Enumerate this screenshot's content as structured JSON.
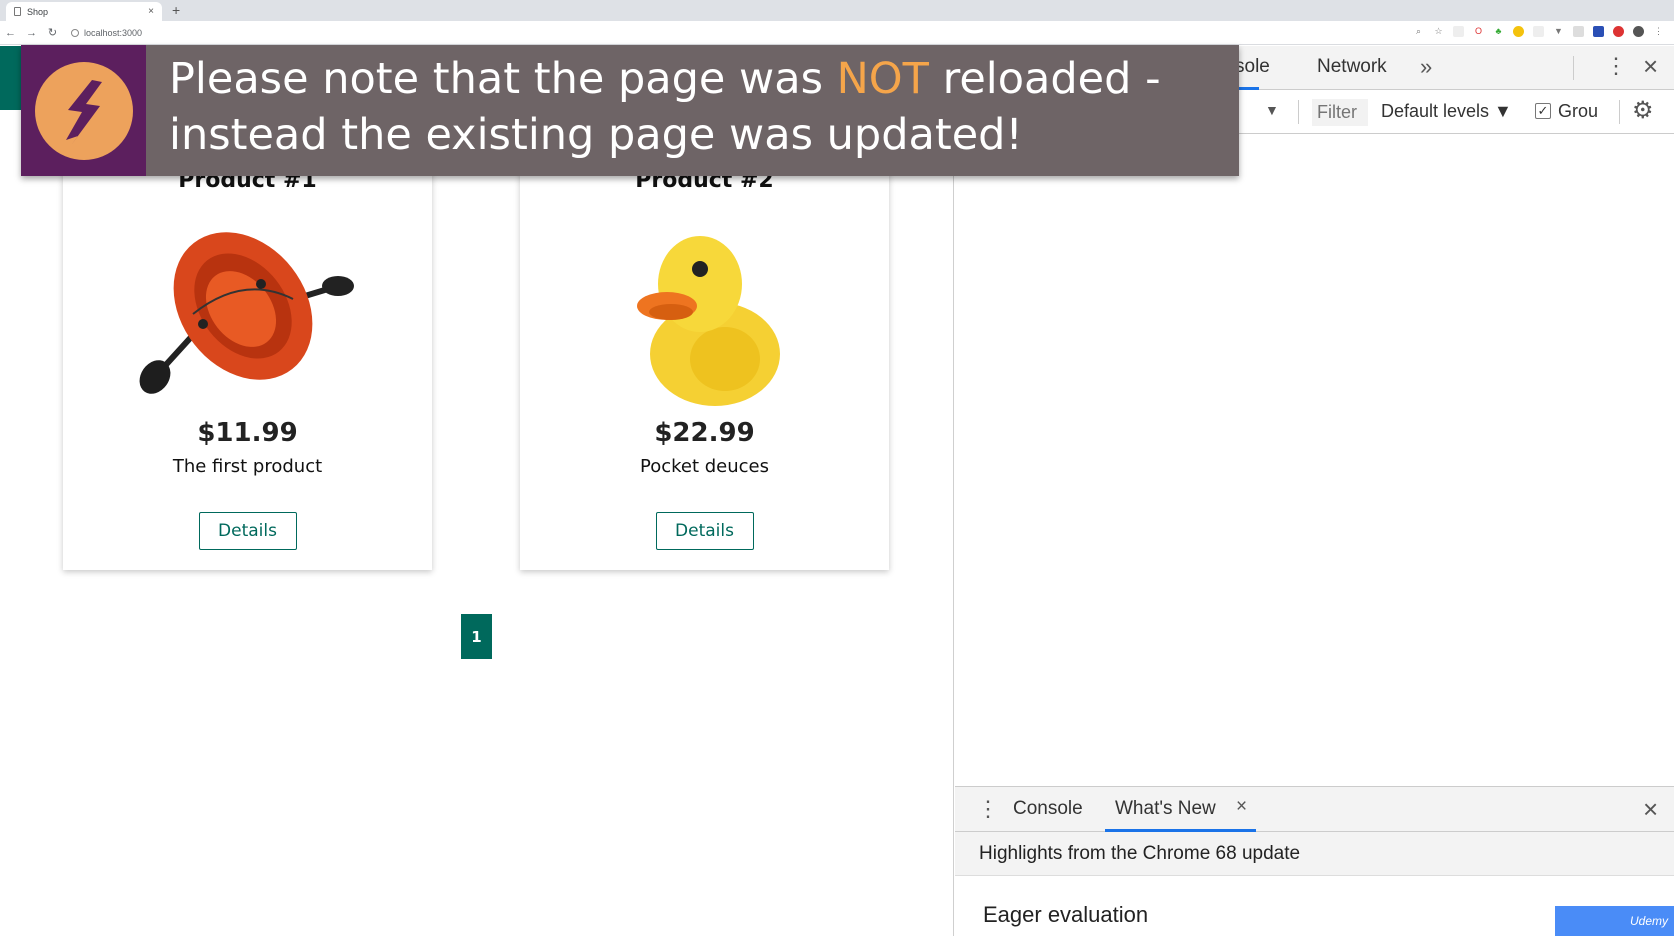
{
  "browser": {
    "tab_title": "Shop",
    "tab_close": "×",
    "new_tab": "+",
    "url": "localhost:3000"
  },
  "overlay": {
    "text_before": "Please note that the page was ",
    "text_highlight": "NOT",
    "text_after": " reloaded - instead the existing page was updated!",
    "highlight_color": "#f5a54a",
    "icon": "lightning-bolt-icon"
  },
  "shop": {
    "products": [
      {
        "title": "Product #1",
        "price": "$11.99",
        "description": "The first product",
        "button": "Details",
        "image": "inflatable-boat"
      },
      {
        "title": "Product #2",
        "price": "$22.99",
        "description": "Pocket deuces",
        "button": "Details",
        "image": "rubber-duck"
      }
    ],
    "pagination": {
      "current_page": "1"
    },
    "accent_color": "#00695c"
  },
  "devtools": {
    "tabs": [
      "sole",
      "Network"
    ],
    "more_tabs": "»",
    "toolbar": {
      "filter_placeholder": "Filter",
      "levels": "Default levels ▼",
      "group_label": "Grou",
      "group_checked": true
    },
    "drawer": {
      "tabs": [
        "Console",
        "What's New"
      ],
      "tab_close": "×",
      "highlights": "Highlights from the Chrome 68 update",
      "section_title": "Eager evaluation"
    }
  },
  "watermark": "Udemy"
}
